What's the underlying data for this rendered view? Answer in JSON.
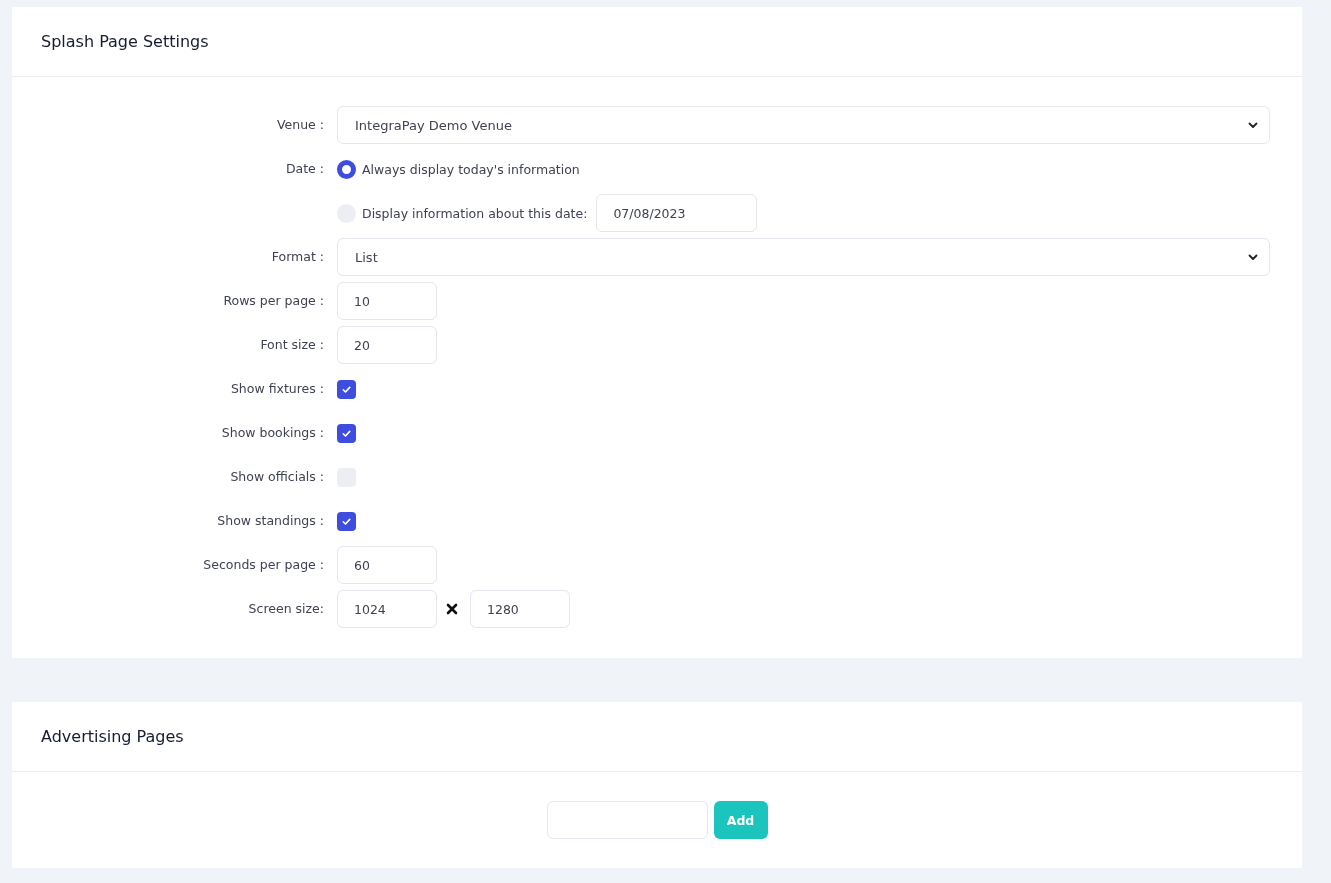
{
  "splash": {
    "title": "Splash Page Settings",
    "fields": [
      {
        "kind": "select",
        "label": "Venue :",
        "value": "IntegraPay Demo Venue"
      },
      {
        "kind": "radio",
        "label": "Date :",
        "options": [
          {
            "label": "Always display today's information",
            "selected": true
          },
          {
            "label": "Display information about this date:",
            "selected": false,
            "value": "07/08/2023"
          }
        ]
      },
      {
        "kind": "select",
        "label": "Format :",
        "value": "List"
      },
      {
        "kind": "text",
        "label": "Rows per page :",
        "value": "10"
      },
      {
        "kind": "text",
        "label": "Font size :",
        "value": "20"
      },
      {
        "kind": "checkbox",
        "label": "Show fixtures :",
        "checked": true
      },
      {
        "kind": "checkbox",
        "label": "Show bookings :",
        "checked": true
      },
      {
        "kind": "checkbox",
        "label": "Show officials :",
        "checked": false
      },
      {
        "kind": "checkbox",
        "label": "Show standings :",
        "checked": true
      },
      {
        "kind": "text",
        "label": "Seconds per page :",
        "value": "60"
      },
      {
        "kind": "pair",
        "label": "Screen size:",
        "values": [
          "1024",
          "1280"
        ]
      }
    ]
  },
  "advertising": {
    "title": "Advertising Pages",
    "button": "Add"
  }
}
